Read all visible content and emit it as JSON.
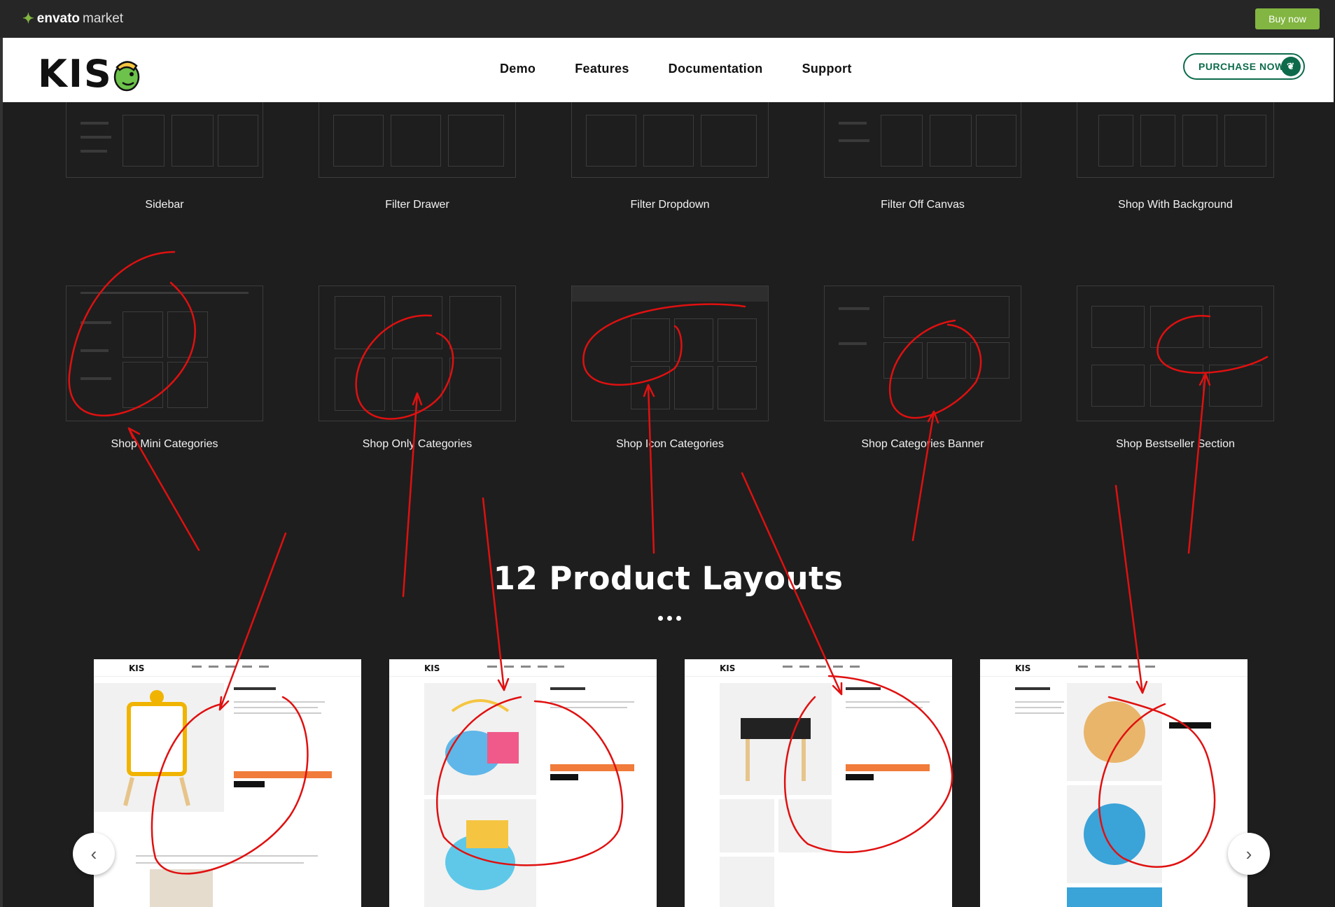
{
  "envato_bar": {
    "logo_bold": "envato",
    "logo_light": "market",
    "buy_now": "Buy now"
  },
  "header": {
    "logo": "KIS",
    "nav": [
      "Demo",
      "Features",
      "Documentation",
      "Support"
    ],
    "purchase": "PURCHASE NOW"
  },
  "shop_layouts_row1": [
    "Sidebar",
    "Filter Drawer",
    "Filter Dropdown",
    "Filter Off Canvas",
    "Shop With Background"
  ],
  "shop_layouts_row2": [
    "Shop Mini Categories",
    "Shop Only Categories",
    "Shop Icon Categories",
    "Shop Categories Banner",
    "Shop Bestseller Section"
  ],
  "product_section": {
    "title": "12 Product Layouts"
  },
  "product_cards": [
    {
      "logo": "KIS"
    },
    {
      "logo": "KIS"
    },
    {
      "logo": "KIS"
    },
    {
      "logo": "KIS"
    }
  ],
  "carousel": {
    "prev_icon": "chevron-left-icon",
    "next_icon": "chevron-right-icon",
    "prev_glyph": "‹",
    "next_glyph": "›"
  },
  "colors": {
    "envato_green": "#82b541",
    "brand_green": "#0d6b4c",
    "annotation_red": "#e01010",
    "accent_orange": "#f07b3a"
  }
}
